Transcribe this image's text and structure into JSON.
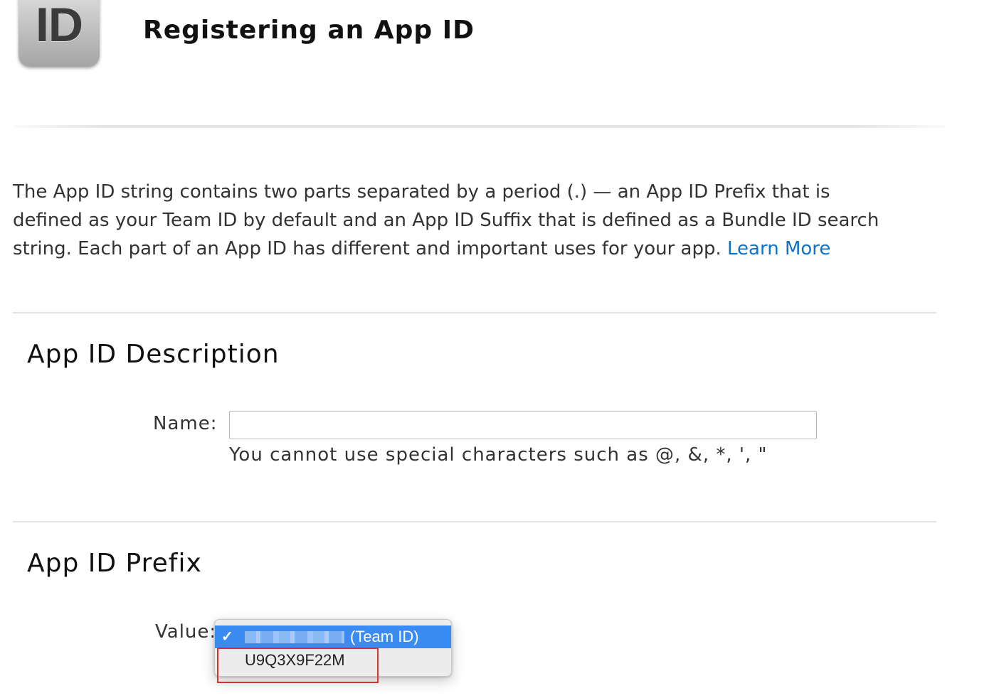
{
  "header": {
    "icon_text": "ID",
    "icon_name": "app-id-icon",
    "title": "Registering an App ID"
  },
  "intro": {
    "line1": "The App ID string contains two parts separated by a period (.) — an App ID Prefix that is",
    "line2": "defined as your Team ID by default and an App ID Suffix that is defined as a Bundle ID search",
    "line3": "string. Each part of an App ID has different and important uses for your app. ",
    "learn_more": "Learn More"
  },
  "description_section": {
    "title": "App ID Description",
    "name_label": "Name:",
    "name_value": "",
    "name_placeholder": "",
    "hint": "You cannot use special characters such as @, &, *, ', \""
  },
  "prefix_section": {
    "title": "App ID Prefix",
    "value_label": "Value:",
    "dropdown": {
      "selected_checkmark": "✓",
      "selected_suffix": "(Team ID)",
      "other_option": "U9Q3X9F22M"
    }
  },
  "colors": {
    "link": "#0d72c8",
    "selection": "#3b8cf2",
    "highlight_box": "#d9322c"
  }
}
